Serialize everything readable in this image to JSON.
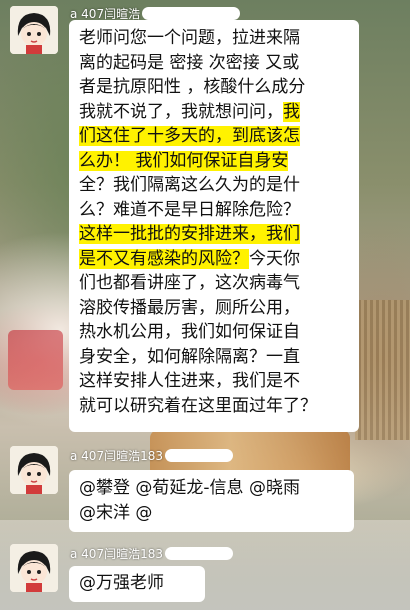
{
  "background": {
    "colors": {
      "foliage": "#6d7f60",
      "highlight": "#fff200",
      "bubble": "#ffffff"
    }
  },
  "messages": [
    {
      "avatar_icon": "cartoon-boy-avatar-icon",
      "sender_prefix": "a 407闫暄浩",
      "lines": [
        [
          {
            "t": "老师问您一个问题，拉进来隔",
            "h": false
          }
        ],
        [
          {
            "t": "离的起码是  密接  次密接 又或",
            "h": false
          }
        ],
        [
          {
            "t": "者是抗原阳性 ，核酸什么成分",
            "h": false
          }
        ],
        [
          {
            "t": "我就不说了，我就想问问，",
            "h": false
          },
          {
            "t": "我",
            "h": true
          }
        ],
        [
          {
            "t": "们这住了十多天的，到底该怎",
            "h": true
          }
        ],
        [
          {
            "t": "么办！  我们如何保证自身安",
            "h": true
          }
        ],
        [
          {
            "t": "全？我们隔离这么久为的是什",
            "h": false
          }
        ],
        [
          {
            "t": "么？难道不是早日解除危险？",
            "h": false
          }
        ],
        [
          {
            "t": "这样一批批的安排进来，我们",
            "h": true
          }
        ],
        [
          {
            "t": "是不又有感染的风险？",
            "h": true
          },
          {
            "t": "今天你",
            "h": false
          }
        ],
        [
          {
            "t": "们也都看讲座了，这次病毒气",
            "h": false
          }
        ],
        [
          {
            "t": "溶胶传播最厉害，厕所公用，",
            "h": false
          }
        ],
        [
          {
            "t": "热水机公用，我们如何保证自",
            "h": false
          }
        ],
        [
          {
            "t": "身安全，如何解除隔离？一直",
            "h": false
          }
        ],
        [
          {
            "t": "这样安排人住进来，我们是不",
            "h": false
          }
        ],
        [
          {
            "t": "就可以研究着在这里面过年了？",
            "h": false
          }
        ]
      ]
    },
    {
      "avatar_icon": "cartoon-boy-avatar-icon",
      "sender_prefix": "a 407闫暄浩183",
      "lines": [
        [
          {
            "t": "@攀登  @荀延龙-信息  @晓雨",
            "h": false
          }
        ],
        [
          {
            "t": "@宋洋  @",
            "h": false
          }
        ]
      ]
    },
    {
      "avatar_icon": "cartoon-boy-avatar-icon",
      "sender_prefix": "a 407闫暄浩183",
      "lines": [
        [
          {
            "t": "@万强老师",
            "h": false
          }
        ]
      ]
    }
  ]
}
